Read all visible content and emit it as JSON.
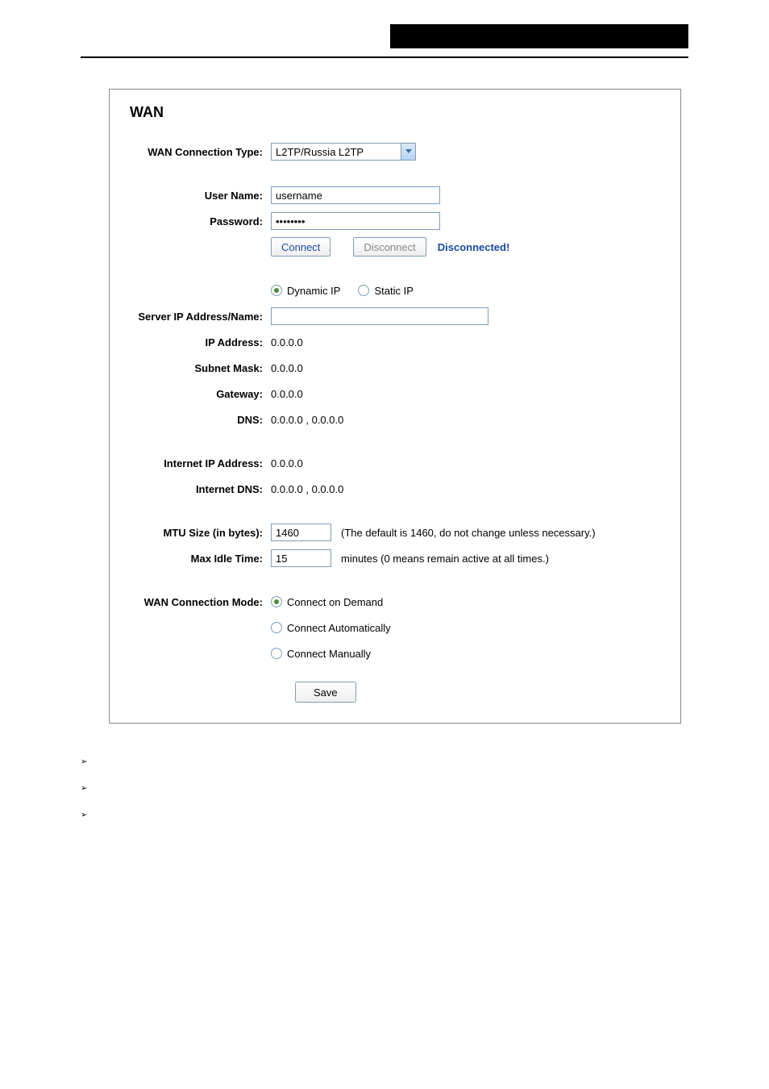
{
  "section_title": "WAN",
  "labels": {
    "connection_type": "WAN Connection Type:",
    "user_name": "User Name:",
    "password": "Password:",
    "server_ip": "Server IP Address/Name:",
    "ip_address": "IP Address:",
    "subnet_mask": "Subnet Mask:",
    "gateway": "Gateway:",
    "dns": "DNS:",
    "internet_ip": "Internet IP Address:",
    "internet_dns": "Internet DNS:",
    "mtu": "MTU Size (in bytes):",
    "max_idle": "Max Idle Time:",
    "conn_mode": "WAN Connection Mode:"
  },
  "values": {
    "connection_type": "L2TP/Russia L2TP",
    "user_name": "username",
    "password": "••••••••",
    "server_ip": "",
    "ip_address": "0.0.0.0",
    "subnet_mask": "0.0.0.0",
    "gateway": "0.0.0.0",
    "dns": "0.0.0.0 , 0.0.0.0",
    "internet_ip": "0.0.0.0",
    "internet_dns": "0.0.0.0 , 0.0.0.0",
    "mtu": "1460",
    "max_idle": "15"
  },
  "buttons": {
    "connect": "Connect",
    "disconnect": "Disconnect",
    "save": "Save"
  },
  "status": "Disconnected!",
  "radios": {
    "dynamic_ip": "Dynamic IP",
    "static_ip": "Static IP",
    "on_demand": "Connect on Demand",
    "auto": "Connect Automatically",
    "manual": "Connect Manually"
  },
  "hints": {
    "mtu": "(The default is 1460, do not change unless necessary.)",
    "max_idle": "minutes (0 means remain active at all times.)"
  }
}
